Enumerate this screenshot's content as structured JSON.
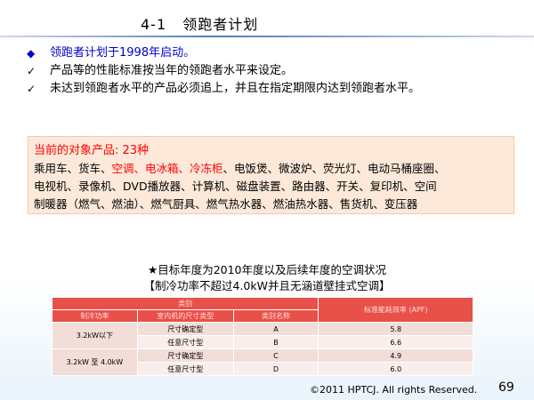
{
  "header": {
    "number": "4-1",
    "title": "领跑者计划"
  },
  "bullets": [
    {
      "mark": "◆",
      "text": "领跑者计划于1998年启动。",
      "style": "blue"
    },
    {
      "mark": "✓",
      "text": "产品等的性能标准按当年的领跑者水平来设定。",
      "style": "black"
    },
    {
      "mark": "✓",
      "text": "未达到领跑者水平的产品必须追上，并且在指定期限内达到领跑者水平。",
      "style": "black"
    }
  ],
  "products": {
    "heading": "当前的对象产品: 23种",
    "line1_a": "乘用车、货车、",
    "line1_red": "空调、电冰箱、冷冻柜",
    "line1_b": "、电饭煲、微波炉、荧光灯、电动马桶座圈、",
    "line2": "电视机、录像机、DVD播放器、计算机、磁盘装置、路由器、开关、复印机、空间",
    "line3": "制暖器（燃气、燃油）、燃气厨具、燃气热水器、燃油热水器、售货机、变压器"
  },
  "table_title": {
    "line1": "★目标年度为2010年度以及后续年度的空调状况",
    "line2": "【制冷功率不超过4.0kW并且无涵道壁挂式空调】"
  },
  "table": {
    "header_category": "类别",
    "header_apf": "标准能耗效率 (APF)",
    "col_power": "制冷功率",
    "col_indoor": "室内机的尺寸类型",
    "col_catname": "类别名称",
    "rows": [
      {
        "power": "3.2kW以下",
        "type": "尺寸确定型",
        "cat": "A",
        "apf": "5.8"
      },
      {
        "type": "任意尺寸型",
        "cat": "B",
        "apf": "6.6"
      },
      {
        "power": "3.2kW 至 4.0kW",
        "type": "尺寸确定型",
        "cat": "C",
        "apf": "4.9"
      },
      {
        "type": "任意尺寸型",
        "cat": "D",
        "apf": "6.0"
      }
    ]
  },
  "footer": {
    "copyright": "©2011 HPTCJ. All rights Reserved.",
    "page": "69"
  }
}
